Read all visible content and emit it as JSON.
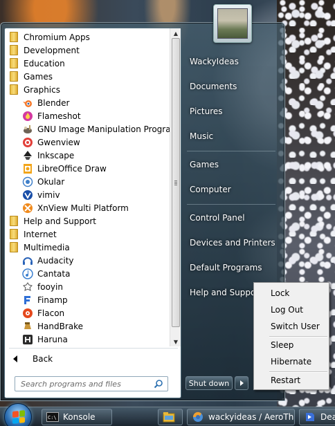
{
  "programs": {
    "items": [
      {
        "kind": "folder",
        "label": "Chromium Apps",
        "icon": "folder-icon"
      },
      {
        "kind": "folder",
        "label": "Development",
        "icon": "folder-icon"
      },
      {
        "kind": "folder",
        "label": "Education",
        "icon": "folder-icon"
      },
      {
        "kind": "folder",
        "label": "Games",
        "icon": "folder-icon"
      },
      {
        "kind": "folder",
        "label": "Graphics",
        "icon": "folder-icon"
      },
      {
        "kind": "app",
        "label": "Blender",
        "icon": "blender-icon",
        "color": "#f5792a"
      },
      {
        "kind": "app",
        "label": "Flameshot",
        "icon": "flameshot-icon",
        "color": "#d43aa0"
      },
      {
        "kind": "app",
        "label": "GNU Image Manipulation Program",
        "icon": "gimp-icon",
        "color": "#6e6356"
      },
      {
        "kind": "app",
        "label": "Gwenview",
        "icon": "gwenview-icon",
        "color": "#e2403a"
      },
      {
        "kind": "app",
        "label": "Inkscape",
        "icon": "inkscape-icon",
        "color": "#222222"
      },
      {
        "kind": "app",
        "label": "LibreOffice Draw",
        "icon": "libreoffice-draw-icon",
        "color": "#f2a51a"
      },
      {
        "kind": "app",
        "label": "Okular",
        "icon": "okular-icon",
        "color": "#3f7fc9"
      },
      {
        "kind": "app",
        "label": "vimiv",
        "icon": "vimiv-icon",
        "color": "#1a4fa8"
      },
      {
        "kind": "app",
        "label": "XnView Multi Platform",
        "icon": "xnview-icon",
        "color": "#f08a1c"
      },
      {
        "kind": "folder",
        "label": "Help and Support",
        "icon": "folder-icon"
      },
      {
        "kind": "folder",
        "label": "Internet",
        "icon": "folder-icon"
      },
      {
        "kind": "folder",
        "label": "Multimedia",
        "icon": "folder-icon"
      },
      {
        "kind": "app",
        "label": "Audacity",
        "icon": "audacity-icon",
        "color": "#2a63b8"
      },
      {
        "kind": "app",
        "label": "Cantata",
        "icon": "cantata-icon",
        "color": "#3a7fd0"
      },
      {
        "kind": "app",
        "label": "fooyin",
        "icon": "fooyin-icon",
        "color": "#555555"
      },
      {
        "kind": "app",
        "label": "Finamp",
        "icon": "finamp-icon",
        "color": "#2f6fd6"
      },
      {
        "kind": "app",
        "label": "Flacon",
        "icon": "flacon-icon",
        "color": "#e5481c"
      },
      {
        "kind": "app",
        "label": "HandBrake",
        "icon": "handbrake-icon",
        "color": "#c9963a"
      },
      {
        "kind": "app",
        "label": "Haruna",
        "icon": "haruna-icon",
        "color": "#2b2b2b"
      }
    ],
    "back_label": "Back",
    "search_placeholder": "Search programs and files"
  },
  "places": {
    "user": "WackyIdeas",
    "documents": "Documents",
    "pictures": "Pictures",
    "music": "Music",
    "games": "Games",
    "computer": "Computer",
    "control_panel": "Control Panel",
    "devices": "Devices and Printers",
    "default_programs": "Default Programs",
    "help": "Help and Support"
  },
  "power": {
    "shutdown_label": "Shut down",
    "menu": [
      "Lock",
      "Log Out",
      "Switch User",
      "Sleep",
      "Hibernate",
      "Restart"
    ]
  },
  "taskbar": {
    "buttons": [
      {
        "label": "Konsole",
        "icon": "konsole-icon"
      },
      {
        "label": "",
        "icon": "file-manager-icon"
      },
      {
        "label": "wackyideas / AeroTh",
        "icon": "browser-icon"
      },
      {
        "label": "Deat",
        "icon": "app-icon"
      }
    ]
  }
}
